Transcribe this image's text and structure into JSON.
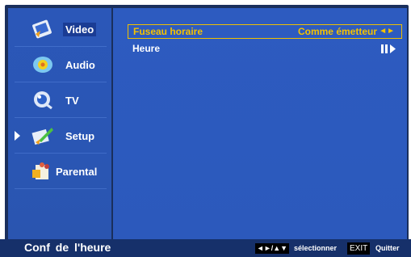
{
  "sidebar": {
    "items": [
      {
        "label": "Video",
        "icon": "video-icon",
        "selected": true
      },
      {
        "label": "Audio",
        "icon": "audio-icon",
        "selected": false
      },
      {
        "label": "TV",
        "icon": "tv-icon",
        "selected": false
      },
      {
        "label": "Setup",
        "icon": "setup-icon",
        "selected": false,
        "cursor": true
      },
      {
        "label": "Parental",
        "icon": "parental-icon",
        "selected": false
      }
    ]
  },
  "menu": {
    "rows": [
      {
        "label": "Fuseau horaire",
        "value": "Comme émetteur",
        "control": "◄►",
        "focused": true
      },
      {
        "label": "Heure",
        "value": "",
        "control": "enter-icon",
        "focused": false
      }
    ]
  },
  "footer": {
    "title": "Conf de  l'heure",
    "nav_keys": "◄►/▲▼",
    "nav_text": "sélectionner",
    "exit_key": "EXIT",
    "exit_text": "Quitter"
  },
  "colors": {
    "panel": "#2d5bc0",
    "sidebar": "#2b57b8",
    "footer": "#16306a",
    "focus": "#f4c200"
  }
}
